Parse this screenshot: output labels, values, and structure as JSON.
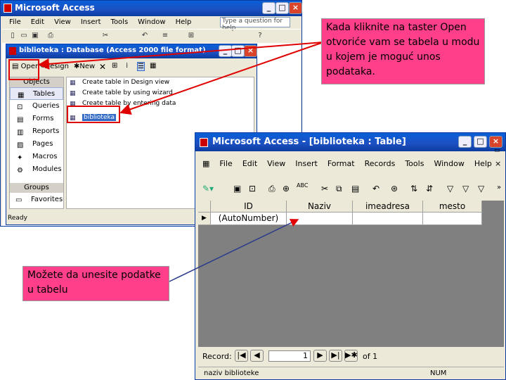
{
  "main_window": {
    "title": "Microsoft Access",
    "menu": [
      "File",
      "Edit",
      "View",
      "Insert",
      "Tools",
      "Window",
      "Help"
    ],
    "help_box": "Type a question for help"
  },
  "db_window": {
    "title": "biblioteka : Database (Access 2000 file format)",
    "toolbar": {
      "open": "Open",
      "design": "Design",
      "new": "New"
    },
    "objects_header": "Objects",
    "objects": [
      {
        "label": "Tables",
        "icon": "table-icon"
      },
      {
        "label": "Queries",
        "icon": "query-icon"
      },
      {
        "label": "Forms",
        "icon": "form-icon"
      },
      {
        "label": "Reports",
        "icon": "report-icon"
      },
      {
        "label": "Pages",
        "icon": "page-icon"
      },
      {
        "label": "Macros",
        "icon": "macro-icon"
      },
      {
        "label": "Modules",
        "icon": "module-icon"
      }
    ],
    "groups_header": "Groups",
    "groups": [
      {
        "label": "Favorites",
        "icon": "favorites-icon"
      }
    ],
    "items": [
      "Create table in Design view",
      "Create table by using wizard",
      "Create table by entering data",
      "biblioteka"
    ],
    "status": "Ready"
  },
  "table_window": {
    "title": "Microsoft Access - [biblioteka : Table]",
    "menu": [
      "File",
      "Edit",
      "View",
      "Insert",
      "Format",
      "Records",
      "Tools",
      "Window",
      "Help"
    ],
    "columns": [
      "ID",
      "Naziv",
      "imeadresa",
      "mesto"
    ],
    "row": [
      "(AutoNumber)",
      "",
      "",
      ""
    ],
    "nav": {
      "label": "Record:",
      "current": "1",
      "of": "of 1"
    },
    "status_left": "naziv biblioteke",
    "status_right": "NUM"
  },
  "callouts": {
    "top": "Kada kliknite na taster Open otvoriće vam se tabela u modu u kojem je moguć unos podataka.",
    "bottom": "Možete da unesite podatke u tabelu"
  },
  "colors": {
    "titlebar": "#0a5fd8",
    "callout": "#ff3f8a",
    "highlight": "#e00000",
    "window_bg": "#ece9d8"
  }
}
